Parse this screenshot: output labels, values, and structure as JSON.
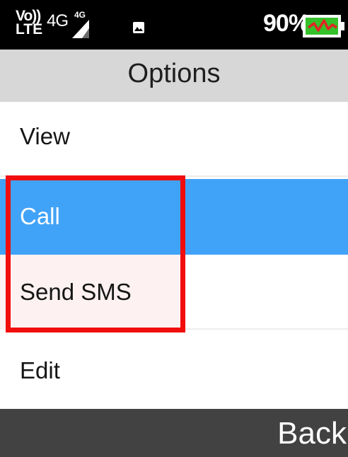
{
  "status_bar": {
    "volte_line1": "Vo))",
    "volte_line2": "LTE",
    "network": "4G",
    "signal_network": "4G",
    "battery_percent": "90%",
    "signal_icon": "signal-bars-icon",
    "notification_icon": "image-icon",
    "battery_icon": "battery-charging-icon"
  },
  "title": "Options",
  "menu": {
    "items": [
      {
        "label": "View"
      },
      {
        "label": "Call"
      },
      {
        "label": "Send SMS"
      },
      {
        "label": "Edit"
      }
    ]
  },
  "softkeys": {
    "right": "Back"
  },
  "colors": {
    "selection": "#41a3f7",
    "highlight_border": "#f20d0d",
    "title_bg": "#d7d7d7",
    "softkey_bg": "#424242"
  }
}
